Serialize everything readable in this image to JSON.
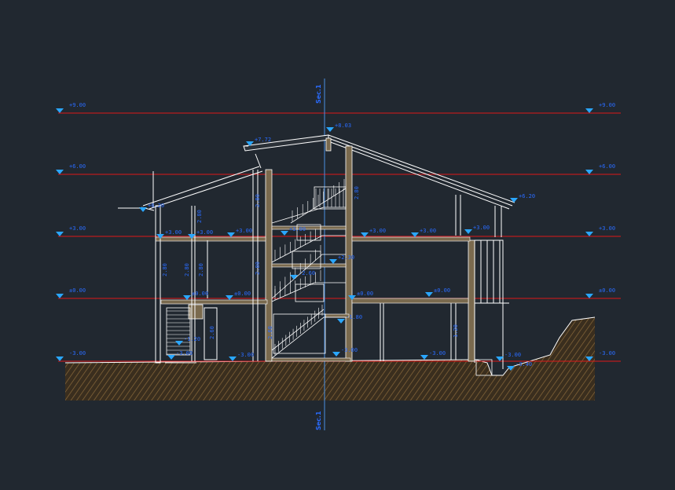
{
  "drawing": {
    "type": "building-section",
    "colors": {
      "background": "#212830",
      "level_line": "#e01818",
      "structure": "#ffffff",
      "section_fill": "#7a6a4e",
      "ground_hatch": "#8a6a3c",
      "annotation": "#2a6cff",
      "marker": "#2aa7ff"
    },
    "section_axis": {
      "top_label": "Sec.1",
      "bottom_label": "Sec.1"
    },
    "levels": [
      {
        "id": "roof-top",
        "label_left": "+9.00",
        "label_right": "+9.00"
      },
      {
        "id": "roof-eave",
        "label_left": "+6.00",
        "label_right": "+6.00"
      },
      {
        "id": "first-floor",
        "label_left": "+3.00",
        "label_right": "+3.00"
      },
      {
        "id": "ground-floor",
        "label_left": "±0.00",
        "label_right": "±0.00"
      },
      {
        "id": "grade",
        "label_left": "-3.00",
        "label_right": "-3.00"
      }
    ],
    "spot_elevations": [
      "+7.72",
      "+8.03",
      "+6.20",
      "+6.20",
      "+3.00",
      "+3.00",
      "+3.00",
      "+3.00",
      "+3.00",
      "+3.00",
      "+3.00",
      "+2.30",
      "±0.00",
      "±0.00",
      "±0.00",
      "±0.00",
      "-1.20",
      "-1.80",
      "-2.60",
      "-3.00",
      "-3.00",
      "-3.00",
      "-3.00",
      "-3.00",
      "-3.40"
    ],
    "dimensions": [
      "2.80",
      "2.80",
      "2.80",
      "2.80",
      "2.80",
      "2.80",
      "2.80",
      "2.60",
      "2.60",
      "1.20"
    ]
  }
}
